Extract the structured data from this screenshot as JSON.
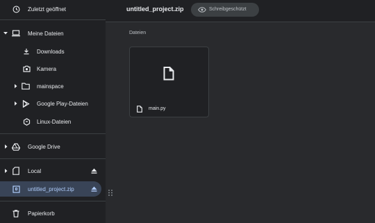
{
  "sidebar": {
    "recent": "Zuletzt geöffnet",
    "my_files": "Meine Dateien",
    "downloads": "Downloads",
    "camera": "Kamera",
    "mainspace": "mainspace",
    "play_files": "Google Play-Dateien",
    "linux_files": "Linux-Dateien",
    "google_drive": "Google Drive",
    "local": "Local",
    "zip": "untitled_project.zip",
    "trash": "Papierkorb"
  },
  "header": {
    "title": "untitled_project.zip",
    "readonly_badge": "Schreibgeschützt"
  },
  "content": {
    "section_label": "Dateien",
    "files": [
      {
        "name": "main.py",
        "icon": "file-icon"
      }
    ]
  },
  "colors": {
    "background": "#202124",
    "main_background": "#292a2d",
    "active_item": "#394457",
    "active_text": "#aecbfa"
  }
}
